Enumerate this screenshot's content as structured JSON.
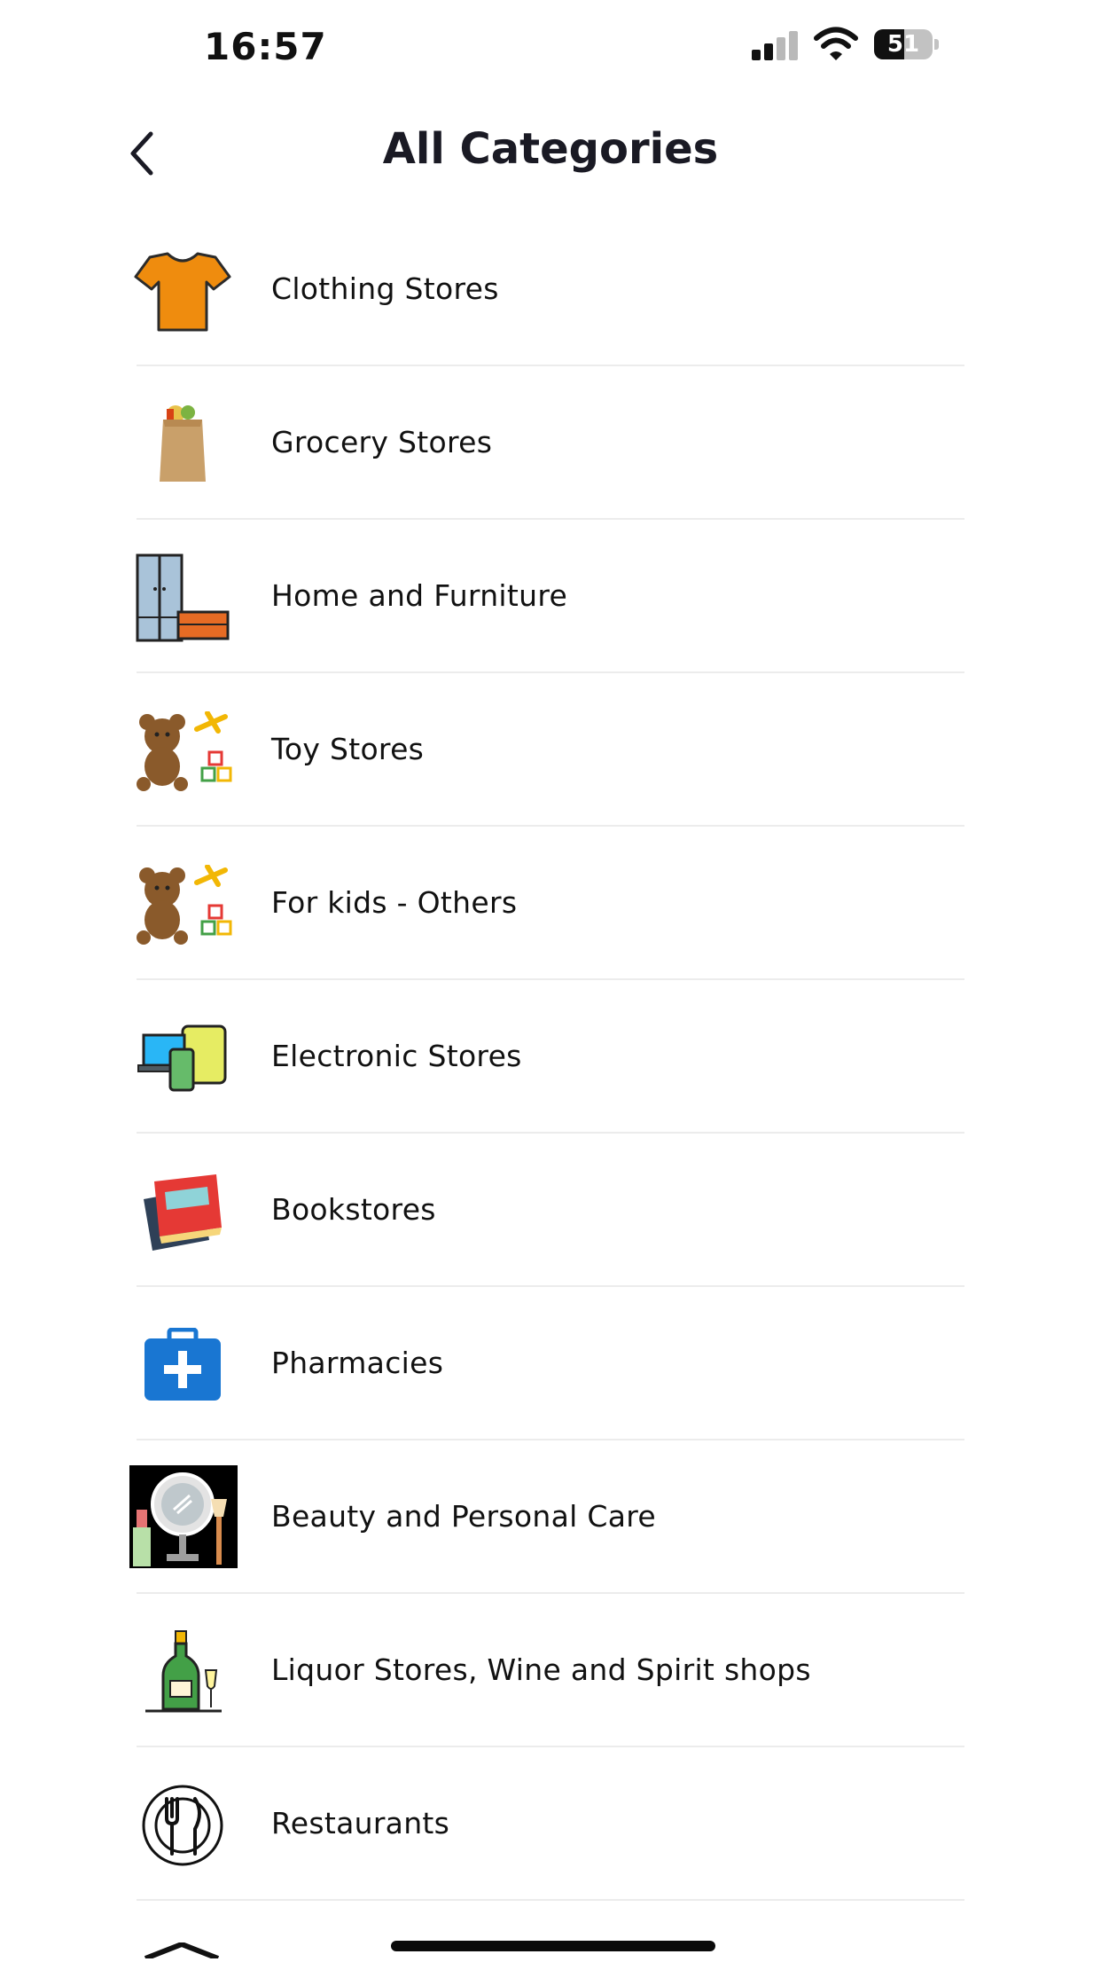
{
  "status_bar": {
    "time": "16:57",
    "battery": "51",
    "battery_level": 0.51
  },
  "header": {
    "title": "All Categories"
  },
  "categories": [
    {
      "label": "Clothing Stores",
      "icon": "t-shirt-icon"
    },
    {
      "label": "Grocery Stores",
      "icon": "grocery-bag-icon"
    },
    {
      "label": "Home and Furniture",
      "icon": "furniture-icon"
    },
    {
      "label": "Toy Stores",
      "icon": "teddy-bear-icon"
    },
    {
      "label": "For kids - Others",
      "icon": "teddy-bear-icon"
    },
    {
      "label": "Electronic Stores",
      "icon": "devices-icon"
    },
    {
      "label": "Bookstores",
      "icon": "books-icon"
    },
    {
      "label": "Pharmacies",
      "icon": "first-aid-kit-icon"
    },
    {
      "label": "Beauty and Personal Care",
      "icon": "cosmetics-mirror-icon"
    },
    {
      "label": "Liquor Stores, Wine and Spirit shops",
      "icon": "wine-bottle-icon"
    },
    {
      "label": "Restaurants",
      "icon": "restaurant-icon"
    }
  ],
  "colors": {
    "title": "#1a1a24",
    "divider": "#ececec",
    "tshirt": "#ef8c0e",
    "pharmacy": "#1976d2"
  }
}
